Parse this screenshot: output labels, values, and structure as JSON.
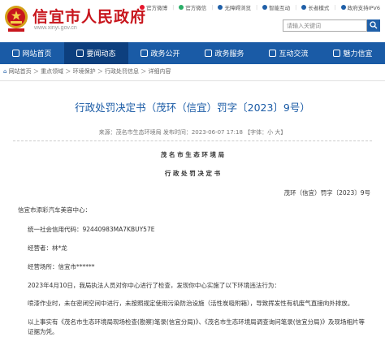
{
  "site": {
    "title": "信宜市人民政府",
    "url": "www.xinyi.gov.cn"
  },
  "toplinks": [
    {
      "label": "官方微博",
      "color": "#e6162d"
    },
    {
      "label": "官方微信",
      "color": "#2aae67"
    },
    {
      "label": "无障碍浏览",
      "color": "#1f5fa8"
    },
    {
      "label": "智能互动",
      "color": "#1f5fa8"
    },
    {
      "label": "长者模式",
      "color": "#1f5fa8"
    },
    {
      "label": "政府支持IPV6",
      "color": "#1f5fa8"
    }
  ],
  "search": {
    "placeholder": "请输入关键词"
  },
  "nav": [
    {
      "label": "网站首页",
      "active": false
    },
    {
      "label": "要闻动态",
      "active": true
    },
    {
      "label": "政务公开",
      "active": false
    },
    {
      "label": "政务服务",
      "active": false
    },
    {
      "label": "互动交流",
      "active": false
    },
    {
      "label": "魅力信宜",
      "active": false
    }
  ],
  "breadcrumb": "网站首页 ＞ 重点领域 ＞ 环境保护 ＞ 行政处罚信息 ＞ 详细内容",
  "article": {
    "title": "行政处罚决定书（茂环（信宜）罚字〔2023〕9号）",
    "meta": "来源：茂名市生态环境局    发布时间：2023-06-07 17:18    【字体：小 大】",
    "org": "茂 名 市 生 态 环 境 局",
    "doc_head": "行 政 处 罚 决 定 书",
    "doc_no": "茂环（信宜）罚字〔2023〕9号",
    "addressee": "信宜市添彩汽车美容中心：",
    "credit_code": "统一社会信用代码：92440983MA7KBUY57E",
    "operator": "经营者：林*龙",
    "location": "经营场所：信宜市******",
    "para1": "2023年4月10日，我局执法人员对你中心进行了检查，发现你中心实施了以下环境违法行为：",
    "para2": "喷漆作业时，未在密闭空间中进行，未按照规定使用污染防治设施（活性炭吸附箱），导致挥发性有机废气直接向外排放。",
    "para3": "以上事实有《茂名市生态环境局现场检查(勘察)笔录(信宜分局)》、《茂名市生态环境局调查询问笔录(信宜分局)》及现场相片等证据为凭。"
  }
}
